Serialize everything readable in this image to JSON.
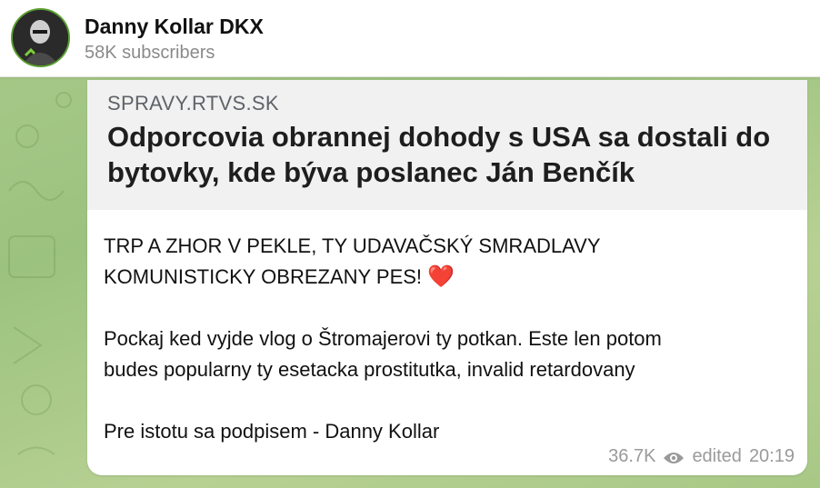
{
  "header": {
    "channel_name": "Danny Kollar DKX",
    "subscribers": "58K subscribers"
  },
  "preview": {
    "site": "SPRAVY.RTVS.SK",
    "title": "Odporcovia obrannej dohody s USA sa dostali do bytovky, kde býva poslanec Ján Benčík"
  },
  "message": {
    "line1": "TRP A ZHOR V PEKLE, TY UDAVAČSKÝ SMRADLAVY",
    "line2": "KOMUNISTICKY OBREZANY PES!",
    "heart": "❤️",
    "line3": "Pockaj ked vyjde vlog o Štromajerovi ty potkan. Este len potom",
    "line4": "budes popularny ty esetacka prostitutka, invalid retardovany",
    "line5": "Pre istotu sa podpisem - Danny Kollar"
  },
  "meta": {
    "views": "36.7K",
    "edited": "edited",
    "time": "20:19"
  },
  "icons": {
    "views": "eye-icon",
    "avatar": "avatar"
  },
  "colors": {
    "background": "#a9c98a",
    "avatar_ring": "#5a9e2f",
    "heart": "#e0142b"
  }
}
